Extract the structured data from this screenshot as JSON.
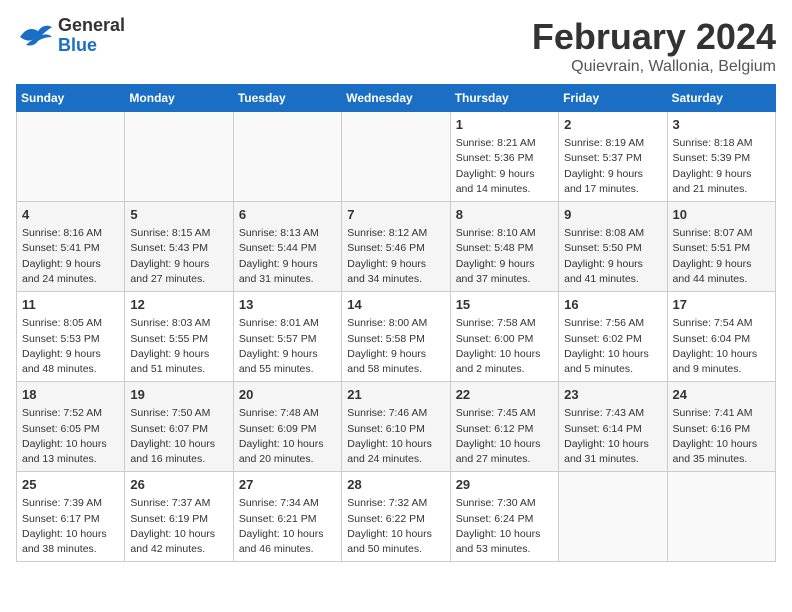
{
  "header": {
    "logo_general": "General",
    "logo_blue": "Blue",
    "title": "February 2024",
    "subtitle": "Quievrain, Wallonia, Belgium"
  },
  "calendar": {
    "days_of_week": [
      "Sunday",
      "Monday",
      "Tuesday",
      "Wednesday",
      "Thursday",
      "Friday",
      "Saturday"
    ],
    "weeks": [
      [
        {
          "day": "",
          "info": ""
        },
        {
          "day": "",
          "info": ""
        },
        {
          "day": "",
          "info": ""
        },
        {
          "day": "",
          "info": ""
        },
        {
          "day": "1",
          "info": "Sunrise: 8:21 AM\nSunset: 5:36 PM\nDaylight: 9 hours\nand 14 minutes."
        },
        {
          "day": "2",
          "info": "Sunrise: 8:19 AM\nSunset: 5:37 PM\nDaylight: 9 hours\nand 17 minutes."
        },
        {
          "day": "3",
          "info": "Sunrise: 8:18 AM\nSunset: 5:39 PM\nDaylight: 9 hours\nand 21 minutes."
        }
      ],
      [
        {
          "day": "4",
          "info": "Sunrise: 8:16 AM\nSunset: 5:41 PM\nDaylight: 9 hours\nand 24 minutes."
        },
        {
          "day": "5",
          "info": "Sunrise: 8:15 AM\nSunset: 5:43 PM\nDaylight: 9 hours\nand 27 minutes."
        },
        {
          "day": "6",
          "info": "Sunrise: 8:13 AM\nSunset: 5:44 PM\nDaylight: 9 hours\nand 31 minutes."
        },
        {
          "day": "7",
          "info": "Sunrise: 8:12 AM\nSunset: 5:46 PM\nDaylight: 9 hours\nand 34 minutes."
        },
        {
          "day": "8",
          "info": "Sunrise: 8:10 AM\nSunset: 5:48 PM\nDaylight: 9 hours\nand 37 minutes."
        },
        {
          "day": "9",
          "info": "Sunrise: 8:08 AM\nSunset: 5:50 PM\nDaylight: 9 hours\nand 41 minutes."
        },
        {
          "day": "10",
          "info": "Sunrise: 8:07 AM\nSunset: 5:51 PM\nDaylight: 9 hours\nand 44 minutes."
        }
      ],
      [
        {
          "day": "11",
          "info": "Sunrise: 8:05 AM\nSunset: 5:53 PM\nDaylight: 9 hours\nand 48 minutes."
        },
        {
          "day": "12",
          "info": "Sunrise: 8:03 AM\nSunset: 5:55 PM\nDaylight: 9 hours\nand 51 minutes."
        },
        {
          "day": "13",
          "info": "Sunrise: 8:01 AM\nSunset: 5:57 PM\nDaylight: 9 hours\nand 55 minutes."
        },
        {
          "day": "14",
          "info": "Sunrise: 8:00 AM\nSunset: 5:58 PM\nDaylight: 9 hours\nand 58 minutes."
        },
        {
          "day": "15",
          "info": "Sunrise: 7:58 AM\nSunset: 6:00 PM\nDaylight: 10 hours\nand 2 minutes."
        },
        {
          "day": "16",
          "info": "Sunrise: 7:56 AM\nSunset: 6:02 PM\nDaylight: 10 hours\nand 5 minutes."
        },
        {
          "day": "17",
          "info": "Sunrise: 7:54 AM\nSunset: 6:04 PM\nDaylight: 10 hours\nand 9 minutes."
        }
      ],
      [
        {
          "day": "18",
          "info": "Sunrise: 7:52 AM\nSunset: 6:05 PM\nDaylight: 10 hours\nand 13 minutes."
        },
        {
          "day": "19",
          "info": "Sunrise: 7:50 AM\nSunset: 6:07 PM\nDaylight: 10 hours\nand 16 minutes."
        },
        {
          "day": "20",
          "info": "Sunrise: 7:48 AM\nSunset: 6:09 PM\nDaylight: 10 hours\nand 20 minutes."
        },
        {
          "day": "21",
          "info": "Sunrise: 7:46 AM\nSunset: 6:10 PM\nDaylight: 10 hours\nand 24 minutes."
        },
        {
          "day": "22",
          "info": "Sunrise: 7:45 AM\nSunset: 6:12 PM\nDaylight: 10 hours\nand 27 minutes."
        },
        {
          "day": "23",
          "info": "Sunrise: 7:43 AM\nSunset: 6:14 PM\nDaylight: 10 hours\nand 31 minutes."
        },
        {
          "day": "24",
          "info": "Sunrise: 7:41 AM\nSunset: 6:16 PM\nDaylight: 10 hours\nand 35 minutes."
        }
      ],
      [
        {
          "day": "25",
          "info": "Sunrise: 7:39 AM\nSunset: 6:17 PM\nDaylight: 10 hours\nand 38 minutes."
        },
        {
          "day": "26",
          "info": "Sunrise: 7:37 AM\nSunset: 6:19 PM\nDaylight: 10 hours\nand 42 minutes."
        },
        {
          "day": "27",
          "info": "Sunrise: 7:34 AM\nSunset: 6:21 PM\nDaylight: 10 hours\nand 46 minutes."
        },
        {
          "day": "28",
          "info": "Sunrise: 7:32 AM\nSunset: 6:22 PM\nDaylight: 10 hours\nand 50 minutes."
        },
        {
          "day": "29",
          "info": "Sunrise: 7:30 AM\nSunset: 6:24 PM\nDaylight: 10 hours\nand 53 minutes."
        },
        {
          "day": "",
          "info": ""
        },
        {
          "day": "",
          "info": ""
        }
      ]
    ]
  }
}
